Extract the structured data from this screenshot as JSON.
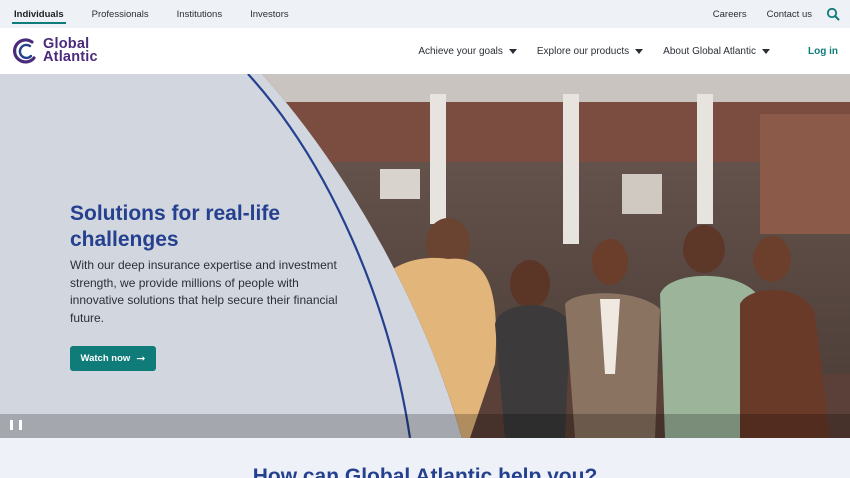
{
  "utility": {
    "segments": [
      "Individuals",
      "Professionals",
      "Institutions",
      "Investors"
    ],
    "active_segment": "Individuals",
    "careers": "Careers",
    "contact": "Contact us"
  },
  "header": {
    "logo_line1": "Global",
    "logo_line2": "Atlantic",
    "nav": [
      "Achieve your goals",
      "Explore our products",
      "About Global Atlantic"
    ],
    "login": "Log in"
  },
  "hero": {
    "title": "Solutions for real-life challenges",
    "body": "With our deep insurance expertise and investment strength, we provide millions of people with innovative solutions that help secure their financial future.",
    "cta": "Watch now",
    "cta_icon": "arrow-right-icon",
    "pause_icon": "pause-icon"
  },
  "help": {
    "title": "How can Global Atlantic help you?"
  },
  "colors": {
    "teal": "#0f7c7a",
    "navy": "#24408f",
    "purple": "#4a2a7a"
  }
}
